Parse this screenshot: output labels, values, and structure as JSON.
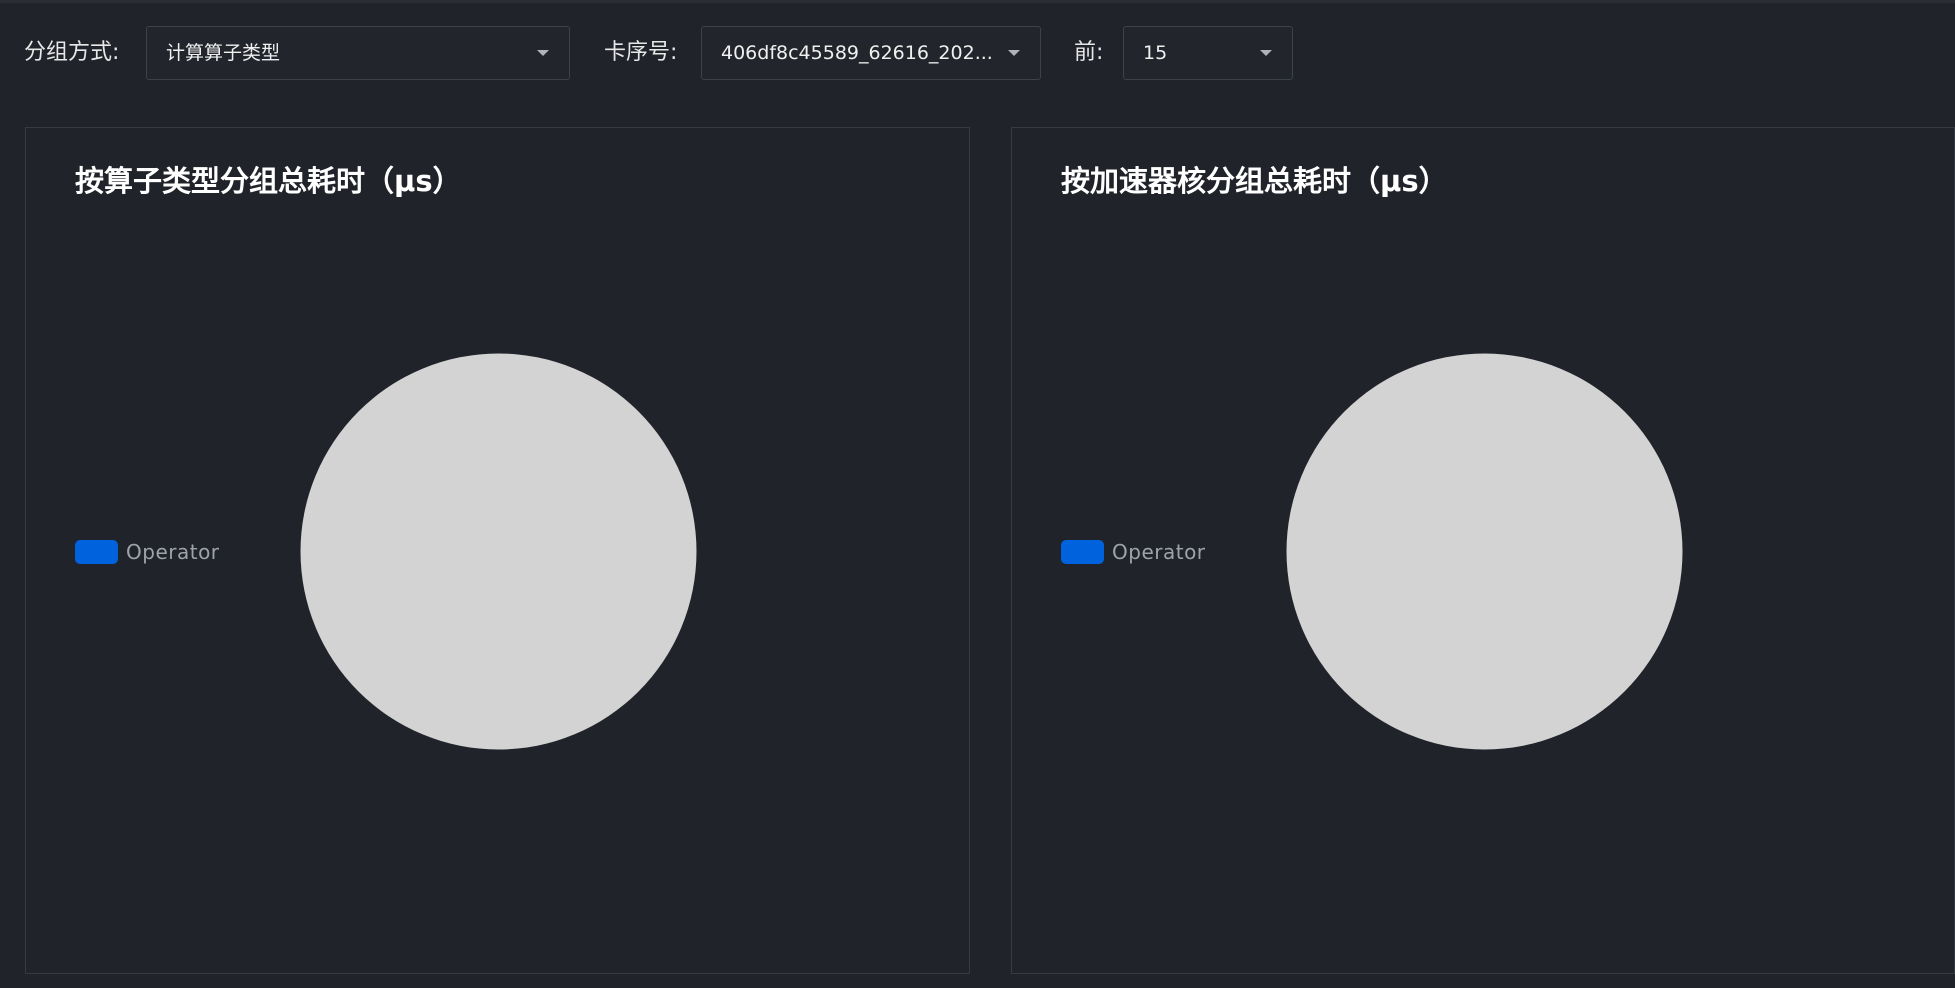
{
  "toolbar": {
    "group_by": {
      "label": "分组方式:",
      "value": "计算算子类型"
    },
    "rank": {
      "label": "卡序号:",
      "value": "406df8c45589_62616_202..."
    },
    "top_n": {
      "label": "前:",
      "value": "15"
    }
  },
  "panels": [
    {
      "title": "按算子类型分组总耗时（μs）",
      "legend": "Operator",
      "legend_color": "#0062dc",
      "pie_color": "#d3d3d3"
    },
    {
      "title": "按加速器核分组总耗时（μs）",
      "legend": "Operator",
      "legend_color": "#0062dc",
      "pie_color": "#d3d3d3"
    }
  ],
  "colors": {
    "background": "#20232a",
    "panel_border": "#363a43",
    "legend_blue": "#0062dc",
    "pie_gray": "#d3d3d3"
  }
}
